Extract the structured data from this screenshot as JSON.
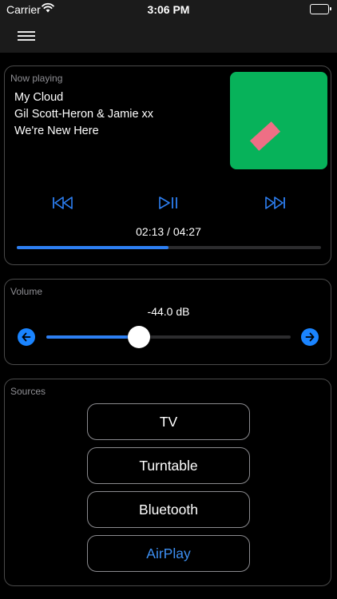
{
  "status_bar": {
    "carrier": "Carrier",
    "time": "3:06 PM"
  },
  "now_playing": {
    "title": "Now playing",
    "track": "My Cloud",
    "artist": "Gil Scott-Heron & Jamie xx",
    "album": "We're New Here",
    "elapsed": "02:13",
    "duration": "04:27",
    "time_display": "02:13 / 04:27",
    "progress_fraction": 0.498,
    "album_art_colors": {
      "background": "#07b25a",
      "mark": "#ee6f85"
    },
    "controls": [
      {
        "name": "previous",
        "icon": "skip-back-icon"
      },
      {
        "name": "play-pause",
        "icon": "play-pause-icon"
      },
      {
        "name": "next",
        "icon": "skip-forward-icon"
      }
    ]
  },
  "volume": {
    "title": "Volume",
    "level_label": "-44.0 dB",
    "level_fraction": 0.38,
    "decrease_icon": "arrow-left-icon",
    "increase_icon": "arrow-right-icon"
  },
  "sources": {
    "title": "Sources",
    "items": [
      {
        "label": "TV",
        "active": false
      },
      {
        "label": "Turntable",
        "active": false
      },
      {
        "label": "Bluetooth",
        "active": false
      },
      {
        "label": "AirPlay",
        "active": true
      }
    ]
  },
  "colors": {
    "accent": "#2d7ff2",
    "active_source": "#3d8ef0",
    "background": "#000000",
    "bar": "#1b1b1b"
  }
}
